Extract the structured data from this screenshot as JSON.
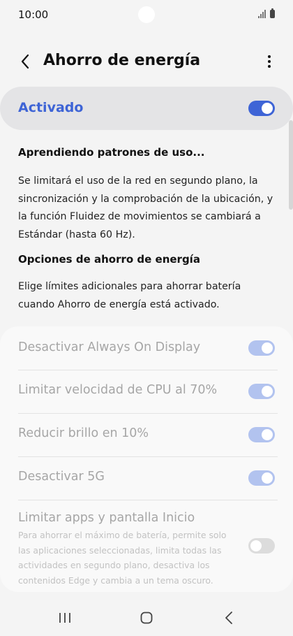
{
  "status_bar": {
    "time": "10:00"
  },
  "header": {
    "title": "Ahorro de energía"
  },
  "master": {
    "label": "Activado",
    "on": true
  },
  "learning": {
    "heading": "Aprendiendo patrones de uso...",
    "text": "Se limitará el uso de la red en segundo plano, la sincronización y la comprobación de la ubicación, y la función Fluidez de movimientos se cambiará a Estándar (hasta 60 Hz)."
  },
  "options_section": {
    "heading": "Opciones de ahorro de energía",
    "text": "Elige límites adicionales para ahorrar batería cuando Ahorro de energía está activado."
  },
  "options": [
    {
      "label": "Desactivar Always On Display",
      "on": true
    },
    {
      "label": "Limitar velocidad de CPU al 70%",
      "on": true
    },
    {
      "label": "Reducir brillo en 10%",
      "on": true
    },
    {
      "label": "Desactivar 5G",
      "on": true
    },
    {
      "label": "Limitar apps y pantalla Inicio",
      "description": "Para ahorrar el máximo de batería, permite solo las aplicaciones seleccionadas, limita todas las actividades en segundo plano, desactiva los contenidos Edge y cambia a un tema oscuro.",
      "on": false
    }
  ],
  "icons": {
    "back": "chevron-left-icon",
    "more": "more-vert-icon",
    "recents": "recents-icon",
    "home": "home-icon",
    "nav_back": "nav-back-icon"
  },
  "colors": {
    "accent": "#3e64d6",
    "toggle_dim": "#b2c3ef",
    "toggle_off": "#dcdcdc"
  }
}
